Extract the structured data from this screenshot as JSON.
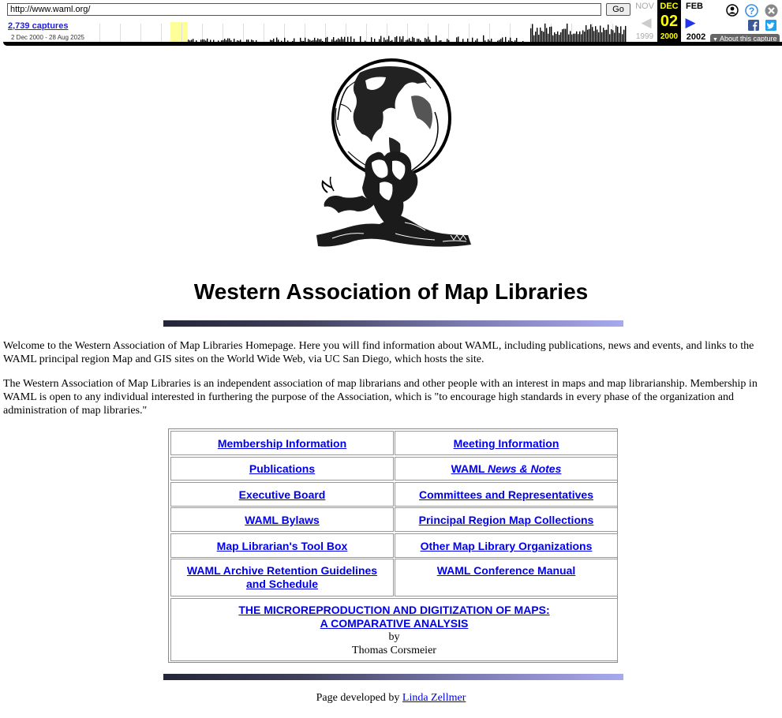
{
  "wayback": {
    "url": "http://www.waml.org/",
    "go_label": "Go",
    "captures_label": "2,739 captures",
    "date_range": "2 Dec 2000 - 28 Aug 2025",
    "prev_month": "NOV",
    "prev_year": "1999",
    "current_month": "DEC",
    "current_day": "02",
    "current_year": "2000",
    "next_month": "FEB",
    "next_year": "2002",
    "about_label": "About this capture",
    "highlight_color": "#ffff99"
  },
  "page": {
    "title": "Western Association of Map Libraries",
    "intro": "Welcome to the Western Association of Map Libraries Homepage. Here you will find information about WAML, including publications, news and events, and links to the WAML principal region Map and GIS sites on the World Wide Web, via UC San Diego, which hosts the site.",
    "about": "The Western Association of Map Libraries is an independent association of map librarians and other people with an interest in maps and map librarianship. Membership in WAML is open to any individual interested in furthering the purpose of the Association, which is \"to encourage high standards in every phase of the organization and administration of map libraries.\"",
    "links": {
      "membership": "Membership Information",
      "meeting": "Meeting Information",
      "publications": "Publications",
      "news_prefix": "WAML ",
      "news_italic": "News & Notes",
      "executive": "Executive Board",
      "committees": "Committees and Representatives",
      "bylaws": "WAML Bylaws",
      "principal": "Principal Region Map Collections",
      "toolbox": "Map Librarian's Tool Box",
      "other_orgs": "Other Map Library Organizations",
      "archive_line1": "WAML Archive Retention Guidelines",
      "archive_line2": "and Schedule",
      "conference": "WAML Conference Manual",
      "micro_line1": "THE MICROREPRODUCTION AND DIGITIZATION OF MAPS:",
      "micro_line2": "A COMPARATIVE ANALYSIS",
      "micro_by": "by",
      "micro_author": "Thomas Corsmeier"
    },
    "footer_prefix": "Page developed by",
    "footer_author": "Linda Zellmer"
  }
}
